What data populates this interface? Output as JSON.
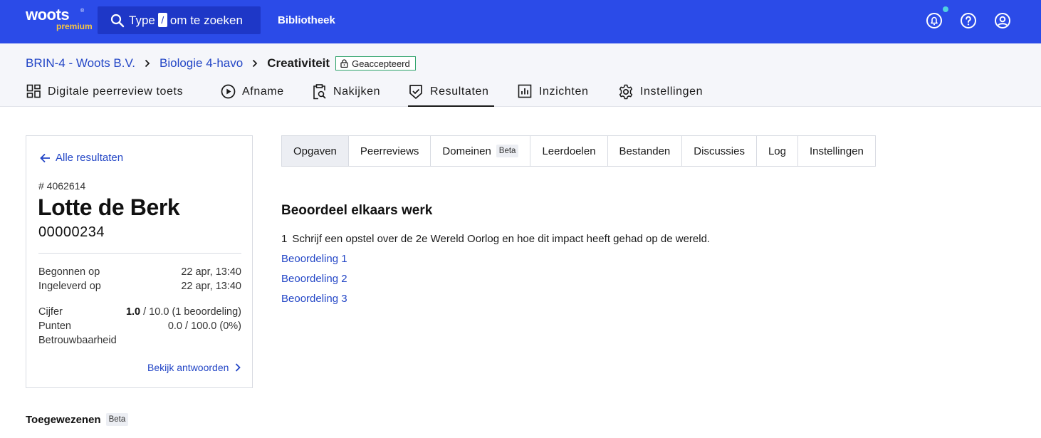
{
  "topbar": {
    "logo_word": "woots",
    "logo_sub": "premium",
    "search_prefix": "Type",
    "search_key": "/",
    "search_suffix": "om te zoeken",
    "library_label": "Bibliotheek",
    "icons": [
      "notification-bell-icon",
      "help-icon",
      "account-icon"
    ]
  },
  "breadcrumb": {
    "items": [
      "BRIN-4 - Woots B.V.",
      "Biologie 4-havo"
    ],
    "current": "Creativiteit",
    "status_badge": "Geaccepteerd"
  },
  "mainnav": {
    "items": [
      {
        "label": "Digitale peerreview toets",
        "icon": "dashboard-icon"
      },
      {
        "label": "Afname",
        "icon": "play-icon"
      },
      {
        "label": "Nakijken",
        "icon": "clipboard-search-icon"
      },
      {
        "label": "Resultaten",
        "icon": "shield-check-icon",
        "active": true
      },
      {
        "label": "Inzichten",
        "icon": "bar-chart-icon"
      },
      {
        "label": "Instellingen",
        "icon": "gear-icon"
      }
    ]
  },
  "result_card": {
    "back_label": "Alle resultaten",
    "candidate_id": "# 4062614",
    "name": "Lotte de Berk",
    "student_number": "00000234",
    "started_label": "Begonnen op",
    "started_value": "22 apr, 13:40",
    "submitted_label": "Ingeleverd op",
    "submitted_value": "22 apr, 13:40",
    "grade_label": "Cijfer",
    "grade_value": "1.0",
    "grade_rest": " / 10.0 (1 beoordeling)",
    "points_label": "Punten",
    "points_value": "0.0 / 100.0 (0%)",
    "reliability_label": "Betrouwbaarheid",
    "view_answers_label": "Bekijk antwoorden"
  },
  "assigned": {
    "title": "Toegewezenen",
    "badge": "Beta"
  },
  "tabs": [
    {
      "label": "Opgaven",
      "active": true
    },
    {
      "label": "Peerreviews"
    },
    {
      "label": "Domeinen",
      "badge": "Beta"
    },
    {
      "label": "Leerdoelen"
    },
    {
      "label": "Bestanden"
    },
    {
      "label": "Discussies"
    },
    {
      "label": "Log"
    },
    {
      "label": "Instellingen"
    }
  ],
  "content": {
    "section_title": "Beoordeel elkaars werk",
    "question_number": "1",
    "question_text": "Schrijf een opstel over de 2e Wereld Oorlog en hoe dit impact heeft gehad op de wereld.",
    "reviews": [
      "Beoordeling 1",
      "Beoordeling 2",
      "Beoordeling 3"
    ]
  },
  "colors": {
    "brand_blue": "#2b4be8",
    "link_blue": "#2346c6",
    "accepted_green": "#2fa36b",
    "logo_yellow": "#f6c544"
  }
}
